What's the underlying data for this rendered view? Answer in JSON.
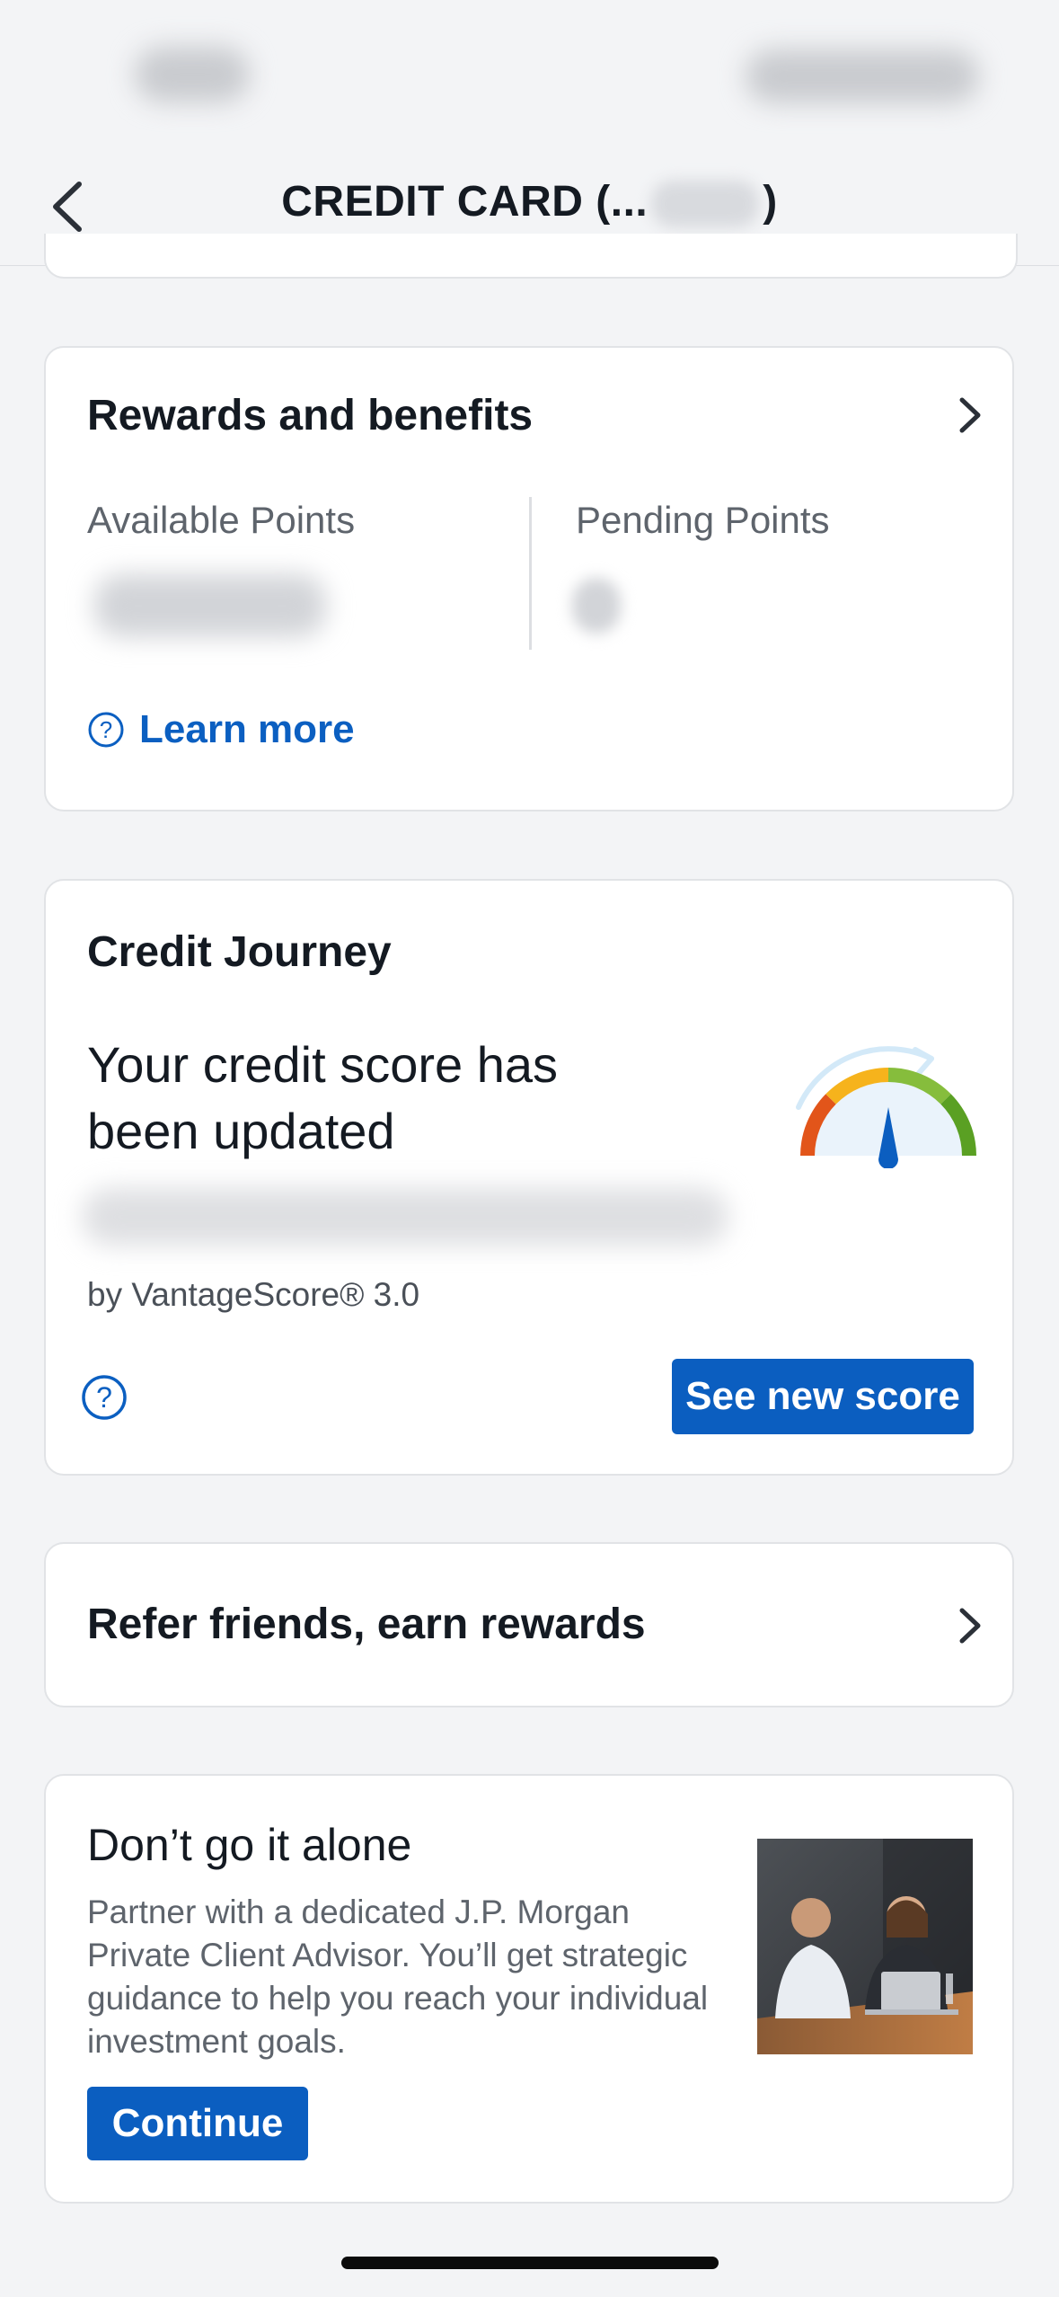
{
  "nav": {
    "title": "CREDIT CARD (...",
    "title_suffix": ")"
  },
  "rewards": {
    "title": "Rewards and benefits",
    "available_label": "Available Points",
    "pending_label": "Pending Points",
    "learn_more": "Learn more"
  },
  "credit_journey": {
    "title": "Credit Journey",
    "headline_line1": "Your credit score has",
    "headline_line2": "been updated",
    "source": "by VantageScore® 3.0",
    "button": "See new score"
  },
  "refer": {
    "title": "Refer friends, earn rewards"
  },
  "advisor": {
    "title": "Don’t go it alone",
    "body_line1": "Partner with a dedicated J.P. Morgan",
    "body_line2": "Private Client Advisor. You’ll get strategic",
    "body_line3": "guidance to help you reach your individual",
    "body_line4": "investment goals.",
    "button": "Continue"
  },
  "colors": {
    "accent": "#0b5ec0",
    "gauge_red": "#e2551a",
    "gauge_yellow": "#f6b31c",
    "gauge_lightgreen": "#86bd3c",
    "gauge_green": "#5aa023"
  }
}
